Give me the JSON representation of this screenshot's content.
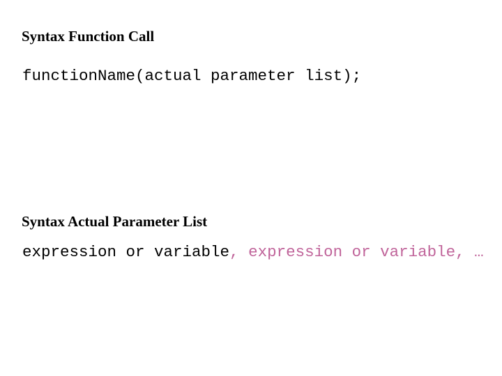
{
  "sections": [
    {
      "heading": "Syntax Function Call",
      "code": "functionName(actual parameter list);"
    },
    {
      "heading": "Syntax Actual Parameter List",
      "code_parts": [
        {
          "text": "expression or variable",
          "color": "#000000"
        },
        {
          "text": ", expression or variable, …",
          "color": "#c0649a"
        }
      ]
    }
  ]
}
